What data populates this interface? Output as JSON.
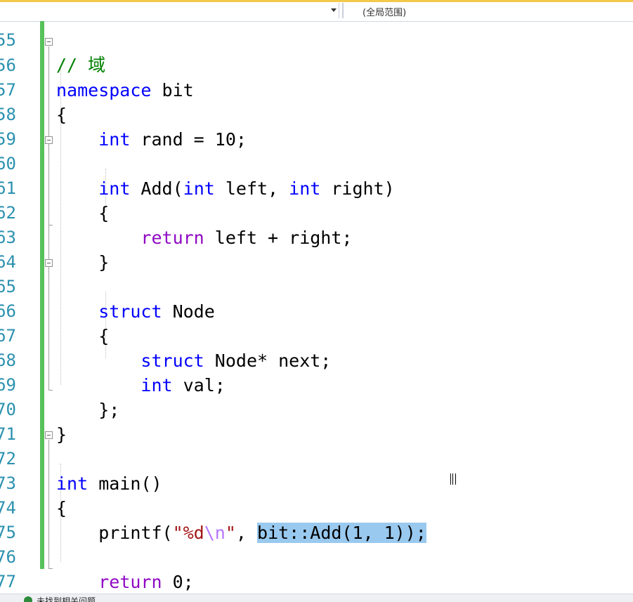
{
  "toolbar": {
    "scope_label": "(全局范围)"
  },
  "editor": {
    "lines": [
      {
        "n": "55",
        "code": "// 域"
      },
      {
        "n": "56",
        "code": "namespace bit"
      },
      {
        "n": "57",
        "code": "{"
      },
      {
        "n": "58",
        "code": "    int rand = 10;"
      },
      {
        "n": "59",
        "code": ""
      },
      {
        "n": "60",
        "code": "    int Add(int left, int right)"
      },
      {
        "n": "61",
        "code": "    {"
      },
      {
        "n": "62",
        "code": "        return left + right;"
      },
      {
        "n": "63",
        "code": "    }"
      },
      {
        "n": "64",
        "code": ""
      },
      {
        "n": "65",
        "code": "    struct Node"
      },
      {
        "n": "66",
        "code": "    {"
      },
      {
        "n": "67",
        "code": "        struct Node* next;"
      },
      {
        "n": "68",
        "code": "        int val;"
      },
      {
        "n": "69",
        "code": "    };"
      },
      {
        "n": "70",
        "code": "}"
      },
      {
        "n": "71",
        "code": ""
      },
      {
        "n": "72",
        "code": "int main()"
      },
      {
        "n": "73",
        "code": "{"
      },
      {
        "n": "74",
        "code": "    printf(\"%d\\n\", bit::Add(1, 1));"
      },
      {
        "n": "75",
        "code": ""
      },
      {
        "n": "76",
        "code": "    return 0;"
      },
      {
        "n": "77",
        "code": "}"
      }
    ],
    "selected_text": "bit::Add(1, 1));"
  },
  "status": {
    "message": "未找到相关问题"
  },
  "colors": {
    "line_number": "#2b91af",
    "keyword": "#0000ff",
    "control_keyword": "#8f08c4",
    "string": "#a31515",
    "selection": "#99c9ef",
    "change_bar": "#57c25a"
  }
}
